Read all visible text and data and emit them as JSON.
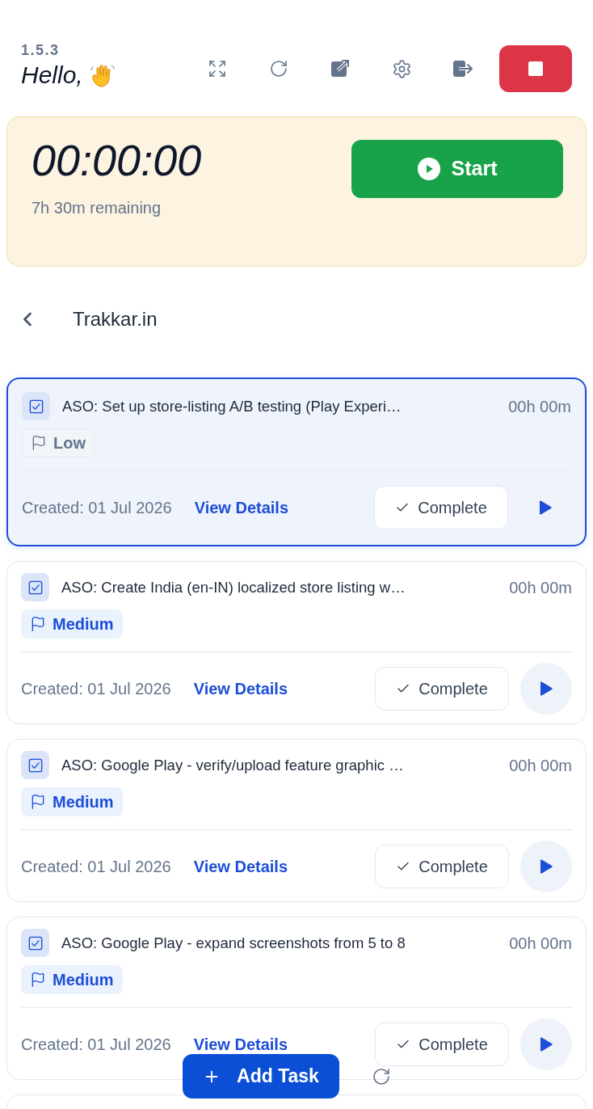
{
  "header": {
    "version": "1.5.3",
    "greeting": "Hello,"
  },
  "timer": {
    "elapsed": "00:00:00",
    "start_label": "Start",
    "remaining": "7h 30m remaining"
  },
  "project": {
    "title": "Trakkar.in"
  },
  "tasks": [
    {
      "title": "ASO: Set up store-listing A/B testing (Play Experi…",
      "duration": "00h 00m",
      "priority": {
        "kind": "low",
        "label": "Low"
      },
      "created": "Created: 01 Jul 2026",
      "details_link": "View Details",
      "complete_label": "Complete",
      "selected": true
    },
    {
      "title": "ASO: Create India (en-IN) localized store listing w…",
      "duration": "00h 00m",
      "priority": {
        "kind": "medium",
        "label": "Medium"
      },
      "created": "Created: 01 Jul 2026",
      "details_link": "View Details",
      "complete_label": "Complete",
      "selected": false
    },
    {
      "title": "ASO: Google Play - verify/upload feature graphic …",
      "duration": "00h 00m",
      "priority": {
        "kind": "medium",
        "label": "Medium"
      },
      "created": "Created: 01 Jul 2026",
      "details_link": "View Details",
      "complete_label": "Complete",
      "selected": false
    },
    {
      "title": "ASO: Google Play - expand screenshots from 5 to 8",
      "duration": "00h 00m",
      "priority": {
        "kind": "medium",
        "label": "Medium"
      },
      "created": "Created: 01 Jul 2026",
      "details_link": "View Details",
      "complete_label": "Complete",
      "selected": false
    }
  ],
  "add_task": {
    "label": "Add Task"
  }
}
